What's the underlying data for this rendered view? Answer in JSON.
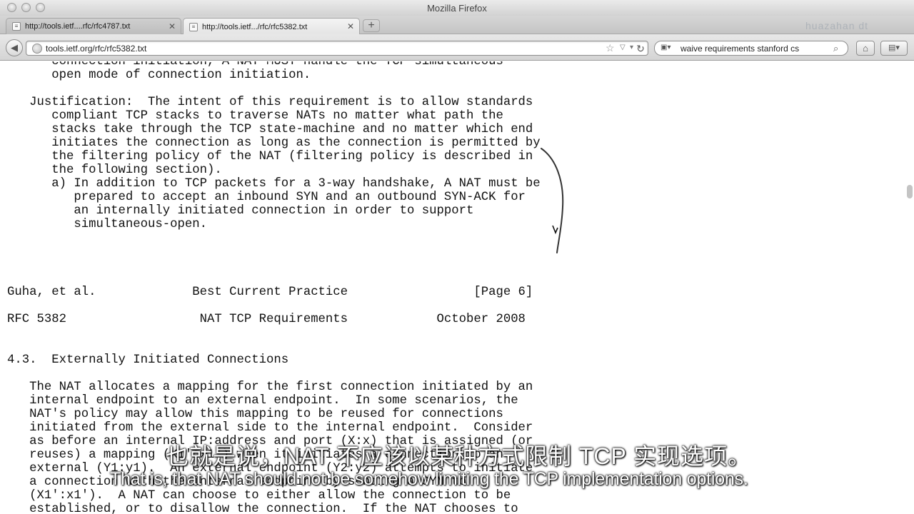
{
  "window": {
    "title": "Mozilla Firefox"
  },
  "tabs": [
    {
      "label": "http://tools.ietf....rfc/rfc4787.txt",
      "active": false
    },
    {
      "label": "http://tools.ietf.../rfc/rfc5382.txt",
      "active": true
    }
  ],
  "toolbar": {
    "new_tab": "+",
    "url": "tools.ietf.org/rfc/rfc5382.txt",
    "search_query": "waive requirements stanford cs",
    "watermark": "huazahan dt"
  },
  "document": {
    "lines": [
      "      connection initiation, A NAT MUST handle the TCP simultaneous-",
      "      open mode of connection initiation.",
      "",
      "   Justification:  The intent of this requirement is to allow standards",
      "      compliant TCP stacks to traverse NATs no matter what path the",
      "      stacks take through the TCP state-machine and no matter which end",
      "      initiates the connection as long as the connection is permitted by",
      "      the filtering policy of the NAT (filtering policy is described in",
      "      the following section).",
      "      a) In addition to TCP packets for a 3-way handshake, A NAT must be",
      "         prepared to accept an inbound SYN and an outbound SYN-ACK for",
      "         an internally initiated connection in order to support",
      "         simultaneous-open.",
      "",
      "",
      "",
      "",
      "Guha, et al.             Best Current Practice                 [Page 6]",
      "",
      "RFC 5382                  NAT TCP Requirements            October 2008",
      "",
      "",
      "4.3.  Externally Initiated Connections",
      "",
      "   The NAT allocates a mapping for the first connection initiated by an",
      "   internal endpoint to an external endpoint.  In some scenarios, the",
      "   NAT's policy may allow this mapping to be reused for connections",
      "   initiated from the external side to the internal endpoint.  Consider",
      "   as before an internal IP:address and port (X:x) that is assigned (or",
      "   reuses) a mapping (X1':x1') when it initiates a connection to an",
      "   external (Y1:y1).  An external endpoint (Y2:y2) attempts to initiate",
      "   a connection with the internal endpoint by sending a SYN to",
      "   (X1':x1').  A NAT can choose to either allow the connection to be",
      "   established, or to disallow the connection.  If the NAT chooses to"
    ]
  },
  "subtitles": {
    "chinese": "也就是说，NAT 不应该以某种方式限制 TCP 实现选项。",
    "english": "That is, that NAT should not be somehow limiting the TCP implementation options."
  }
}
